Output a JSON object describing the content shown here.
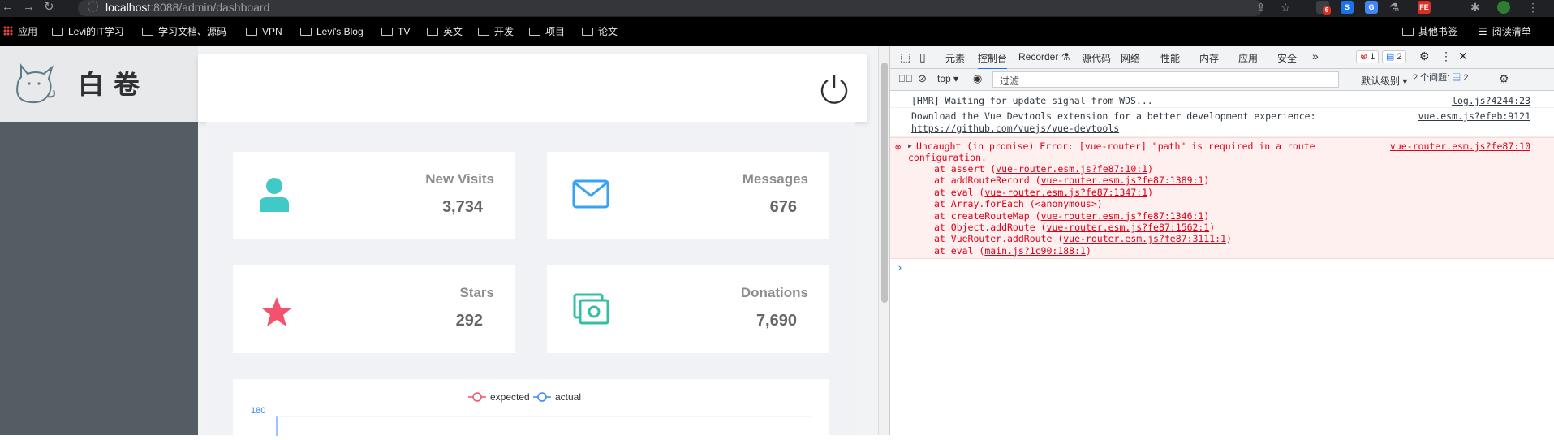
{
  "browser": {
    "url_host": "localhost",
    "url_rest": ":8088/admin/dashboard",
    "bookmarks": [
      {
        "label": "应用"
      },
      {
        "label": "Levi的IT学习"
      },
      {
        "label": "学习文档、源码"
      },
      {
        "label": "VPN"
      },
      {
        "label": "Levi's Blog"
      },
      {
        "label": "TV"
      },
      {
        "label": "英文"
      },
      {
        "label": "开发"
      },
      {
        "label": "项目"
      },
      {
        "label": "论文"
      }
    ],
    "other_bookmarks": "其他书签",
    "reading_list": "阅读清单",
    "ext_badge": "6",
    "ext_fe": "FE"
  },
  "app": {
    "brand": "白卷",
    "cards": [
      {
        "label": "New Visits",
        "value": "3,734",
        "icon": "user-icon",
        "color": "#40c9c6"
      },
      {
        "label": "Messages",
        "value": "676",
        "icon": "message-icon",
        "color": "#36a3f7"
      },
      {
        "label": "Stars",
        "value": "292",
        "icon": "star-icon",
        "color": "#f4516c"
      },
      {
        "label": "Donations",
        "value": "7,690",
        "icon": "money-icon",
        "color": "#34bfa3"
      }
    ],
    "chart_data": {
      "type": "line",
      "series": [
        {
          "name": "expected",
          "color": "#f4516c",
          "values": []
        },
        {
          "name": "actual",
          "color": "#3888fa",
          "values": []
        }
      ],
      "ytick_top": "180"
    }
  },
  "devtools": {
    "tabs": [
      "元素",
      "控制台",
      "Recorder ⚗",
      "源代码",
      "网络",
      "性能",
      "内存",
      "应用",
      "安全"
    ],
    "active_tab": "控制台",
    "more": "»",
    "error_count": "1",
    "message_count": "2",
    "context": "top ▾",
    "filter_placeholder": "过滤",
    "level": "默认级别 ▾",
    "issues_label": "2 个问题:",
    "issues_count": "2",
    "logs": [
      {
        "text": "[HMR] Waiting for update signal from WDS...",
        "source": "log.js?4244:23"
      },
      {
        "text": "Download the Vue Devtools extension for a better development experience:",
        "link": "https://github.com/vuejs/vue-devtools",
        "source": "vue.esm.js?efeb:9121"
      }
    ],
    "error": {
      "head1": "Uncaught (in promise) Error: [vue-router] \"path\" is required in a route",
      "head2": "configuration.",
      "source": "vue-router.esm.js?fe87:10",
      "stack": [
        {
          "fn": "at assert (",
          "loc": "vue-router.esm.js?fe87:10:1",
          "end": ")"
        },
        {
          "fn": "at addRouteRecord (",
          "loc": "vue-router.esm.js?fe87:1389:1",
          "end": ")"
        },
        {
          "fn": "at eval (",
          "loc": "vue-router.esm.js?fe87:1347:1",
          "end": ")"
        },
        {
          "fn": "at Array.forEach (<anonymous>)",
          "loc": "",
          "end": ""
        },
        {
          "fn": "at createRouteMap (",
          "loc": "vue-router.esm.js?fe87:1346:1",
          "end": ")"
        },
        {
          "fn": "at Object.addRoute (",
          "loc": "vue-router.esm.js?fe87:1562:1",
          "end": ")"
        },
        {
          "fn": "at VueRouter.addRoute (",
          "loc": "vue-router.esm.js?fe87:3111:1",
          "end": ")"
        },
        {
          "fn": "at eval (",
          "loc": "main.js?1c90:188:1",
          "end": ")"
        }
      ]
    },
    "prompt": "›"
  }
}
